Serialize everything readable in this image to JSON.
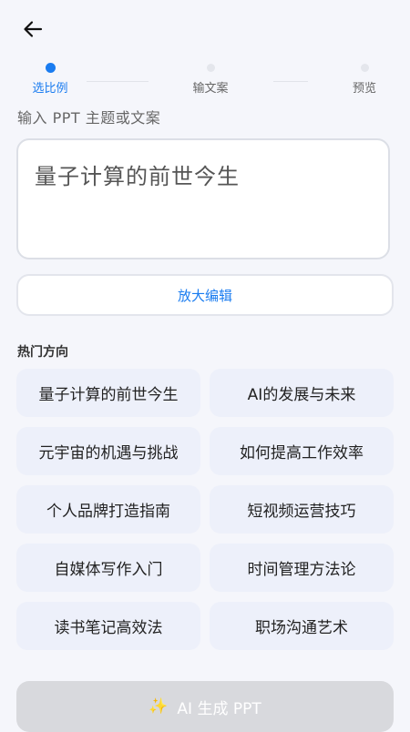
{
  "steps": [
    {
      "label": "选比例",
      "active": true
    },
    {
      "label": "输文案",
      "active": false
    },
    {
      "label": "预览",
      "active": false
    }
  ],
  "input_section": {
    "title": "输入 PPT 主题或文案",
    "value": "量子计算的前世今生",
    "expand_button": "放大编辑"
  },
  "hot": {
    "title": "热门方向",
    "items": [
      "量子计算的前世今生",
      "AI的发展与未来",
      "元宇宙的机遇与挑战",
      "如何提高工作效率",
      "个人品牌打造指南",
      "短视频运营技巧",
      "自媒体写作入门",
      "时间管理方法论",
      "读书笔记高效法",
      "职场沟通艺术"
    ]
  },
  "generate_button": {
    "icon": "sparkles-icon",
    "label": "AI 生成 PPT"
  },
  "colors": {
    "accent": "#1a7cf0",
    "background": "#f5f6fb",
    "chip": "#edf0fa",
    "disabled_button": "#d8d9dd"
  }
}
